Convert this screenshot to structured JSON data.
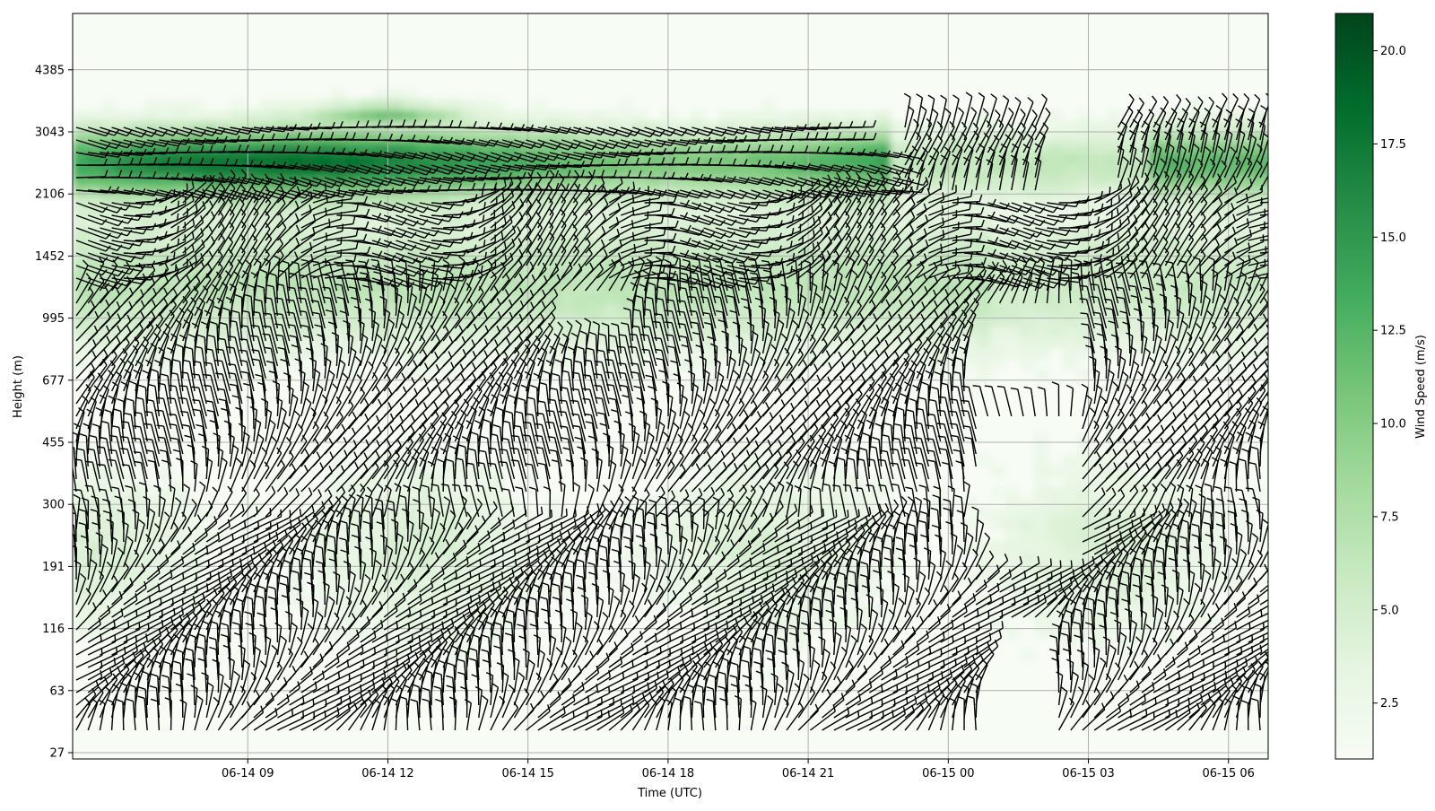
{
  "chart_data": {
    "type": "heatmap",
    "title": "",
    "xlabel": "Time (UTC)",
    "ylabel": "Height (m)",
    "colorbar_label": "Wind Speed (m/s)",
    "colormap": [
      "#f7fcf5",
      "#e5f5e0",
      "#c7e9c0",
      "#a1d99b",
      "#74c476",
      "#41ab5d",
      "#238b45",
      "#006d2c",
      "#00441b"
    ],
    "grid": true,
    "x_range_hours": [
      -3.75,
      21.85
    ],
    "x_ticks": [
      {
        "hour": 0,
        "label": "06-14 09"
      },
      {
        "hour": 3,
        "label": "06-14 12"
      },
      {
        "hour": 6,
        "label": "06-14 15"
      },
      {
        "hour": 9,
        "label": "06-14 18"
      },
      {
        "hour": 12,
        "label": "06-14 21"
      },
      {
        "hour": 15,
        "label": "06-15 00"
      },
      {
        "hour": 18,
        "label": "06-15 03"
      },
      {
        "hour": 21,
        "label": "06-15 06"
      }
    ],
    "y_ticks": [
      "27",
      "63",
      "116",
      "191",
      "300",
      "455",
      "677",
      "995",
      "1452",
      "2106",
      "3043",
      "4385"
    ],
    "colorbar": {
      "range": [
        1,
        21
      ],
      "ticks": [
        "2.5",
        "5.0",
        "7.5",
        "10.0",
        "12.5",
        "15.0",
        "17.5",
        "20.0"
      ]
    },
    "wind_speed_bands": [
      {
        "height_band": "2106-3043",
        "max_speed": 19,
        "note": "strong jet layer"
      },
      {
        "height_band": "1452-2106",
        "max_speed": 12
      },
      {
        "height_band": "677-1452",
        "max_speed": 9
      },
      {
        "height_band": "27-677",
        "max_speed": 7
      }
    ]
  }
}
